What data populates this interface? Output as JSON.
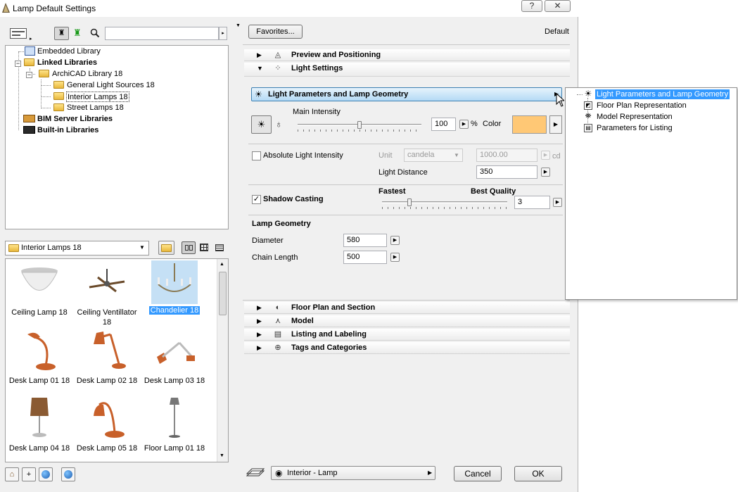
{
  "window": {
    "title": "Lamp Default Settings",
    "help_label": "?",
    "close_label": "✕"
  },
  "library": {
    "search_placeholder": "",
    "tree": [
      {
        "label": "Embedded Library",
        "bold": false
      },
      {
        "label": "Linked Libraries",
        "bold": true
      },
      {
        "label": "ArchiCAD Library 18",
        "bold": false
      },
      {
        "label": "General Light Sources 18",
        "bold": false
      },
      {
        "label": "Interior Lamps 18",
        "bold": false
      },
      {
        "label": "Street Lamps 18",
        "bold": false
      },
      {
        "label": "BIM Server Libraries",
        "bold": true
      },
      {
        "label": "Built-in Libraries",
        "bold": true
      }
    ],
    "folder_select": "Interior Lamps 18",
    "items": [
      {
        "label": "Ceiling Lamp 18"
      },
      {
        "label": "Ceiling Ventillator 18"
      },
      {
        "label": "Chandelier 18"
      },
      {
        "label": "Desk Lamp 01 18"
      },
      {
        "label": "Desk Lamp 02 18"
      },
      {
        "label": "Desk Lamp 03 18"
      },
      {
        "label": "Desk Lamp 04 18"
      },
      {
        "label": "Desk Lamp 05 18"
      },
      {
        "label": "Floor Lamp 01 18"
      }
    ],
    "selected_item": "Chandelier 18"
  },
  "settings": {
    "favorites_label": "Favorites...",
    "default_label": "Default",
    "sections_top": [
      {
        "label": "Preview and Positioning",
        "expanded": false,
        "icon": "preview-icon"
      },
      {
        "label": "Light Settings",
        "expanded": true,
        "icon": "light-settings-icon"
      }
    ],
    "page_dropdown": "Light Parameters and Lamp Geometry",
    "main_intensity_label": "Main Intensity",
    "intensity_value": "100",
    "intensity_fraction": 0.5,
    "percent_label": "%",
    "color_label": "Color",
    "color_value": "#ffc875",
    "absolute_light_label": "Absolute Light Intensity",
    "absolute_light_checked": false,
    "unit_label": "Unit",
    "unit_value": "candela",
    "abs_value": "1000.00",
    "cd_label": "cd",
    "light_distance_label": "Light Distance",
    "light_distance_value": "350",
    "shadow_casting_label": "Shadow Casting",
    "shadow_casting_checked": true,
    "fastest_label": "Fastest",
    "best_quality_label": "Best Quality",
    "quality_value": "3",
    "quality_fraction": 0.22,
    "lamp_geometry_label": "Lamp Geometry",
    "diameter_label": "Diameter",
    "diameter_value": "580",
    "chain_length_label": "Chain Length",
    "chain_length_value": "500",
    "sections_bottom": [
      {
        "label": "Floor Plan and Section",
        "icon": "floor-plan-icon"
      },
      {
        "label": "Model",
        "icon": "model-icon"
      },
      {
        "label": "Listing and Labeling",
        "icon": "listing-icon"
      },
      {
        "label": "Tags and Categories",
        "icon": "tags-icon"
      }
    ],
    "layer_value": "Interior - Lamp",
    "cancel_label": "Cancel",
    "ok_label": "OK"
  },
  "popup_menu": {
    "items": [
      {
        "label": "Light Parameters and Lamp Geometry",
        "selected": true
      },
      {
        "label": "Floor Plan Representation",
        "selected": false
      },
      {
        "label": "Model Representation",
        "selected": false
      },
      {
        "label": "Parameters for Listing",
        "selected": false
      }
    ]
  }
}
